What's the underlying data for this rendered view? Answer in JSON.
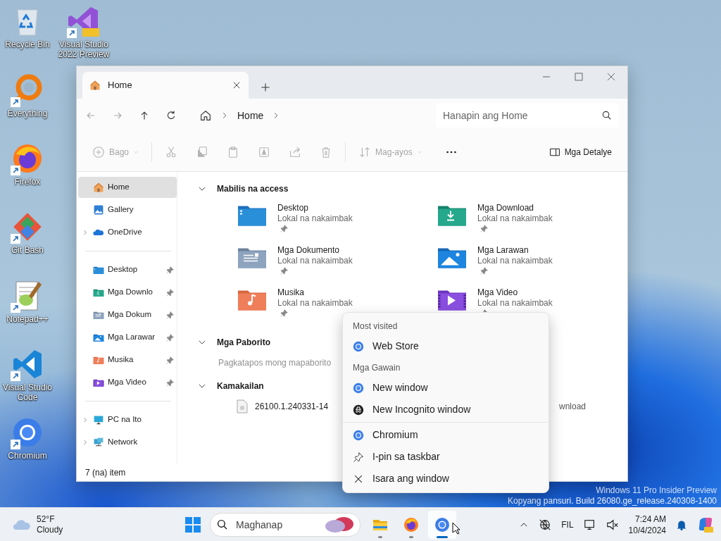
{
  "desktop_icons": [
    {
      "label": "Recycle Bin",
      "kind": "recycle",
      "shortcut": false
    },
    {
      "label": "Visual Studio 2022 Preview",
      "kind": "vs",
      "shortcut": true
    },
    {
      "label": "Everything",
      "kind": "everything",
      "shortcut": true
    },
    {
      "label": "Firefox",
      "kind": "firefox",
      "shortcut": true
    },
    {
      "label": "Git Bash",
      "kind": "git",
      "shortcut": true
    },
    {
      "label": "Notepad++",
      "kind": "notepad",
      "shortcut": true
    },
    {
      "label": "Visual Studio Code",
      "kind": "vscode",
      "shortcut": true
    },
    {
      "label": "Chromium",
      "kind": "chromium",
      "shortcut": true
    }
  ],
  "window": {
    "tabs": [
      {
        "label": "Home",
        "selected": true
      }
    ],
    "address": {
      "crumbs": [
        "Home"
      ],
      "search_placeholder": "Hanapin ang Home"
    },
    "toolbar": [
      {
        "kind": "new",
        "label": "Bago",
        "disabled": true
      },
      {
        "kind": "cut",
        "disabled": true
      },
      {
        "kind": "copy",
        "disabled": true
      },
      {
        "kind": "paste",
        "disabled": true
      },
      {
        "kind": "rename",
        "disabled": true
      },
      {
        "kind": "share",
        "disabled": true
      },
      {
        "kind": "delete",
        "disabled": true
      },
      {
        "kind": "sort",
        "label": "Mag-ayos",
        "disabled": true
      },
      {
        "kind": "more",
        "disabled": false
      }
    ],
    "details_label": "Mga Detalye",
    "sidebar": {
      "groups": [
        [
          {
            "label": "Home",
            "kind": "home",
            "expandable": false,
            "pinned": false,
            "selected": true
          },
          {
            "label": "Gallery",
            "kind": "gallery",
            "expandable": false,
            "pinned": false,
            "selected": false
          },
          {
            "label": "OneDrive",
            "kind": "cloud",
            "expandable": true,
            "pinned": false,
            "selected": false
          }
        ],
        [
          {
            "label": "Desktop",
            "kind": "desktop",
            "expandable": false,
            "pinned": true,
            "selected": false
          },
          {
            "label": "Mga Downlo",
            "kind": "download",
            "expandable": false,
            "pinned": true,
            "selected": false
          },
          {
            "label": "Mga Dokum",
            "kind": "document",
            "expandable": false,
            "pinned": true,
            "selected": false
          },
          {
            "label": "Mga Larawar",
            "kind": "picture",
            "expandable": false,
            "pinned": true,
            "selected": false
          },
          {
            "label": "Musika",
            "kind": "music",
            "expandable": false,
            "pinned": true,
            "selected": false
          },
          {
            "label": "Mga Video",
            "kind": "video",
            "expandable": false,
            "pinned": true,
            "selected": false
          }
        ],
        [
          {
            "label": "PC na Ito",
            "kind": "pc",
            "expandable": true,
            "pinned": false,
            "selected": false
          },
          {
            "label": "Network",
            "kind": "network",
            "expandable": true,
            "pinned": false,
            "selected": false
          }
        ]
      ]
    },
    "sections": [
      {
        "kind": "folders",
        "title": "Mabilis na access",
        "expanded": true,
        "items": [
          {
            "name": "Desktop",
            "location": "Lokal na nakaimbak",
            "kind": "desktop",
            "pinned": true
          },
          {
            "name": "Mga Download",
            "location": "Lokal na nakaimbak",
            "kind": "download",
            "pinned": true
          },
          {
            "name": "Mga Dokumento",
            "location": "Lokal na nakaimbak",
            "kind": "document",
            "pinned": true
          },
          {
            "name": "Mga Larawan",
            "location": "Lokal na nakaimbak",
            "kind": "picture",
            "pinned": true
          },
          {
            "name": "Musika",
            "location": "Lokal na nakaimbak",
            "kind": "music",
            "pinned": true
          },
          {
            "name": "Mga Video",
            "location": "Lokal na nakaimbak",
            "kind": "video",
            "pinned": true
          }
        ]
      },
      {
        "kind": "note",
        "title": "Mga Paborito",
        "expanded": true,
        "note": "Pagkatapos mong mapaborito"
      },
      {
        "kind": "files",
        "title": "Kamakailan",
        "expanded": true,
        "files": [
          {
            "name": "26100.1.240331-14",
            "location": "wnload"
          }
        ]
      }
    ],
    "status_bar": "7 (na) item"
  },
  "jump_list": [
    {
      "heading": "Most visited",
      "items": [
        {
          "label": "Web Store",
          "kind": "chromium"
        }
      ]
    },
    {
      "heading": "Mga Gawain",
      "items": [
        {
          "label": "New window",
          "kind": "chromium"
        },
        {
          "label": "New Incognito window",
          "kind": "incognito"
        }
      ]
    },
    {
      "items": [
        {
          "label": "Chromium",
          "kind": "chromium"
        },
        {
          "label": "I-pin sa taskbar",
          "kind": "pin"
        },
        {
          "label": "Isara ang window",
          "kind": "close"
        }
      ]
    }
  ],
  "watermark": [
    "Windows 11 Pro Insider Preview",
    "Kopyang pansuri. Build 26080.ge_release.240308-1400"
  ],
  "taskbar": {
    "weather": {
      "temperature": "52°F",
      "condition": "Cloudy"
    },
    "search_placeholder": "Maghanap",
    "apps": [
      {
        "kind": "explorer",
        "running": true,
        "active": false
      },
      {
        "kind": "firefox",
        "running": true,
        "active": false
      },
      {
        "kind": "chromium",
        "running": true,
        "active": true
      }
    ],
    "language": "FIL",
    "time": "7:24 AM",
    "date": "10/4/2024"
  }
}
